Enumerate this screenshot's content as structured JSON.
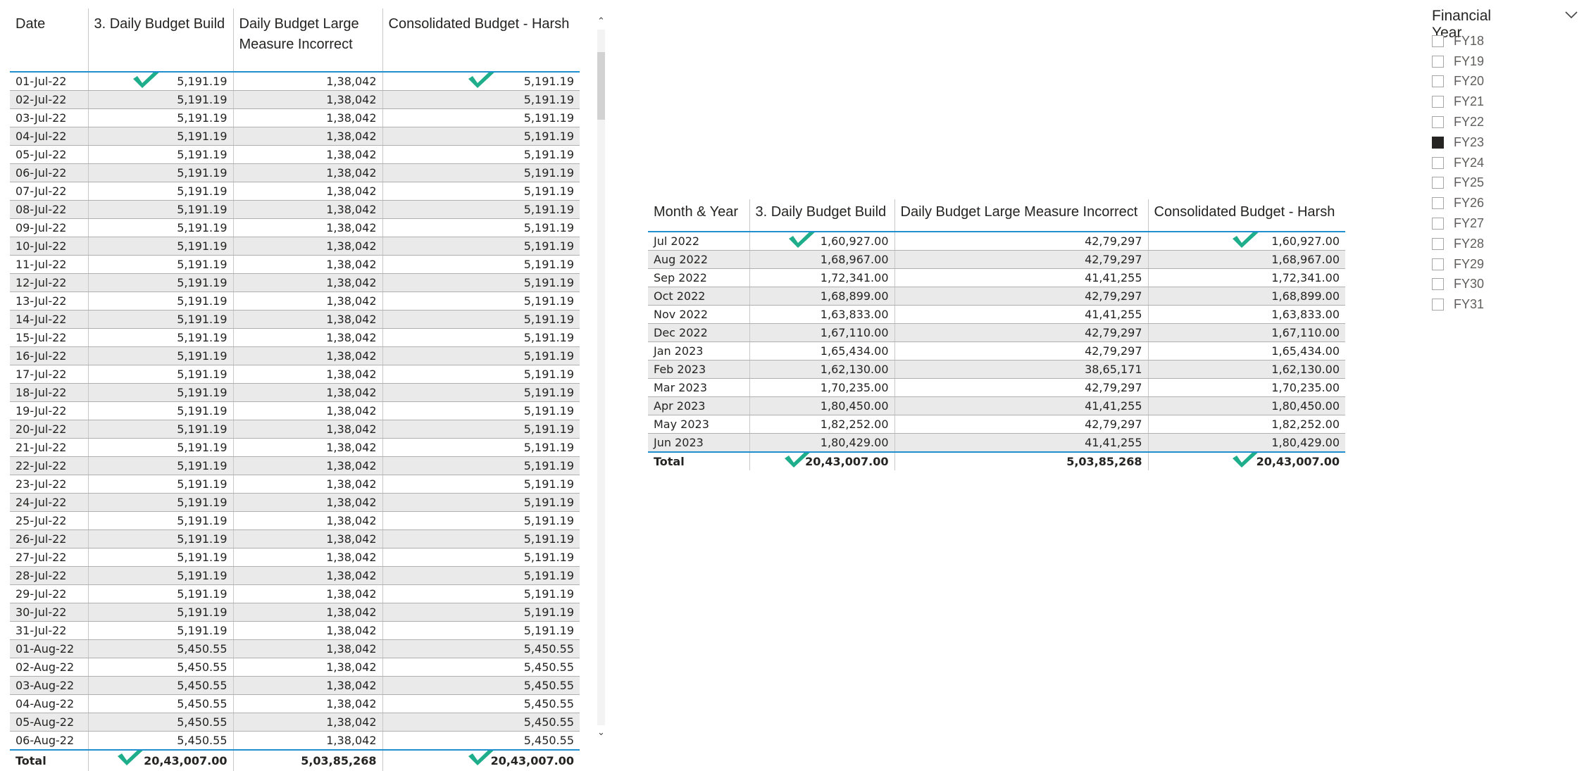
{
  "left_table": {
    "headers": [
      "Date",
      "3. Daily Budget Build",
      "Daily Budget Large Measure Incorrect",
      "Consolidated Budget - Harsh"
    ],
    "rows": [
      [
        "01-Jul-22",
        "5,191.19",
        "1,38,042",
        "5,191.19"
      ],
      [
        "02-Jul-22",
        "5,191.19",
        "1,38,042",
        "5,191.19"
      ],
      [
        "03-Jul-22",
        "5,191.19",
        "1,38,042",
        "5,191.19"
      ],
      [
        "04-Jul-22",
        "5,191.19",
        "1,38,042",
        "5,191.19"
      ],
      [
        "05-Jul-22",
        "5,191.19",
        "1,38,042",
        "5,191.19"
      ],
      [
        "06-Jul-22",
        "5,191.19",
        "1,38,042",
        "5,191.19"
      ],
      [
        "07-Jul-22",
        "5,191.19",
        "1,38,042",
        "5,191.19"
      ],
      [
        "08-Jul-22",
        "5,191.19",
        "1,38,042",
        "5,191.19"
      ],
      [
        "09-Jul-22",
        "5,191.19",
        "1,38,042",
        "5,191.19"
      ],
      [
        "10-Jul-22",
        "5,191.19",
        "1,38,042",
        "5,191.19"
      ],
      [
        "11-Jul-22",
        "5,191.19",
        "1,38,042",
        "5,191.19"
      ],
      [
        "12-Jul-22",
        "5,191.19",
        "1,38,042",
        "5,191.19"
      ],
      [
        "13-Jul-22",
        "5,191.19",
        "1,38,042",
        "5,191.19"
      ],
      [
        "14-Jul-22",
        "5,191.19",
        "1,38,042",
        "5,191.19"
      ],
      [
        "15-Jul-22",
        "5,191.19",
        "1,38,042",
        "5,191.19"
      ],
      [
        "16-Jul-22",
        "5,191.19",
        "1,38,042",
        "5,191.19"
      ],
      [
        "17-Jul-22",
        "5,191.19",
        "1,38,042",
        "5,191.19"
      ],
      [
        "18-Jul-22",
        "5,191.19",
        "1,38,042",
        "5,191.19"
      ],
      [
        "19-Jul-22",
        "5,191.19",
        "1,38,042",
        "5,191.19"
      ],
      [
        "20-Jul-22",
        "5,191.19",
        "1,38,042",
        "5,191.19"
      ],
      [
        "21-Jul-22",
        "5,191.19",
        "1,38,042",
        "5,191.19"
      ],
      [
        "22-Jul-22",
        "5,191.19",
        "1,38,042",
        "5,191.19"
      ],
      [
        "23-Jul-22",
        "5,191.19",
        "1,38,042",
        "5,191.19"
      ],
      [
        "24-Jul-22",
        "5,191.19",
        "1,38,042",
        "5,191.19"
      ],
      [
        "25-Jul-22",
        "5,191.19",
        "1,38,042",
        "5,191.19"
      ],
      [
        "26-Jul-22",
        "5,191.19",
        "1,38,042",
        "5,191.19"
      ],
      [
        "27-Jul-22",
        "5,191.19",
        "1,38,042",
        "5,191.19"
      ],
      [
        "28-Jul-22",
        "5,191.19",
        "1,38,042",
        "5,191.19"
      ],
      [
        "29-Jul-22",
        "5,191.19",
        "1,38,042",
        "5,191.19"
      ],
      [
        "30-Jul-22",
        "5,191.19",
        "1,38,042",
        "5,191.19"
      ],
      [
        "31-Jul-22",
        "5,191.19",
        "1,38,042",
        "5,191.19"
      ],
      [
        "01-Aug-22",
        "5,450.55",
        "1,38,042",
        "5,450.55"
      ],
      [
        "02-Aug-22",
        "5,450.55",
        "1,38,042",
        "5,450.55"
      ],
      [
        "03-Aug-22",
        "5,450.55",
        "1,38,042",
        "5,450.55"
      ],
      [
        "04-Aug-22",
        "5,450.55",
        "1,38,042",
        "5,450.55"
      ],
      [
        "05-Aug-22",
        "5,450.55",
        "1,38,042",
        "5,450.55"
      ],
      [
        "06-Aug-22",
        "5,450.55",
        "1,38,042",
        "5,450.55"
      ]
    ],
    "total": [
      "Total",
      "20,43,007.00",
      "5,03,85,268",
      "20,43,007.00"
    ]
  },
  "middle_table": {
    "headers": [
      "Month & Year",
      "3. Daily Budget Build",
      "Daily Budget Large Measure Incorrect",
      "Consolidated Budget - Harsh"
    ],
    "rows": [
      [
        "Jul 2022",
        "1,60,927.00",
        "42,79,297",
        "1,60,927.00"
      ],
      [
        "Aug 2022",
        "1,68,967.00",
        "42,79,297",
        "1,68,967.00"
      ],
      [
        "Sep 2022",
        "1,72,341.00",
        "41,41,255",
        "1,72,341.00"
      ],
      [
        "Oct 2022",
        "1,68,899.00",
        "42,79,297",
        "1,68,899.00"
      ],
      [
        "Nov 2022",
        "1,63,833.00",
        "41,41,255",
        "1,63,833.00"
      ],
      [
        "Dec 2022",
        "1,67,110.00",
        "42,79,297",
        "1,67,110.00"
      ],
      [
        "Jan 2023",
        "1,65,434.00",
        "42,79,297",
        "1,65,434.00"
      ],
      [
        "Feb 2023",
        "1,62,130.00",
        "38,65,171",
        "1,62,130.00"
      ],
      [
        "Mar 2023",
        "1,70,235.00",
        "42,79,297",
        "1,70,235.00"
      ],
      [
        "Apr 2023",
        "1,80,450.00",
        "41,41,255",
        "1,80,450.00"
      ],
      [
        "May 2023",
        "1,82,252.00",
        "42,79,297",
        "1,82,252.00"
      ],
      [
        "Jun 2023",
        "1,80,429.00",
        "41,41,255",
        "1,80,429.00"
      ]
    ],
    "total": [
      "Total",
      "20,43,007.00",
      "5,03,85,268",
      "20,43,007.00"
    ]
  },
  "slicer": {
    "title": "Financial Year",
    "items": [
      {
        "label": "FY18",
        "selected": false
      },
      {
        "label": "FY19",
        "selected": false
      },
      {
        "label": "FY20",
        "selected": false
      },
      {
        "label": "FY21",
        "selected": false
      },
      {
        "label": "FY22",
        "selected": false
      },
      {
        "label": "FY23",
        "selected": true
      },
      {
        "label": "FY24",
        "selected": false
      },
      {
        "label": "FY25",
        "selected": false
      },
      {
        "label": "FY26",
        "selected": false
      },
      {
        "label": "FY27",
        "selected": false
      },
      {
        "label": "FY28",
        "selected": false
      },
      {
        "label": "FY29",
        "selected": false
      },
      {
        "label": "FY30",
        "selected": false
      },
      {
        "label": "FY31",
        "selected": false
      }
    ]
  },
  "icons": {
    "checkmark": "checkmark-icon",
    "dropdown": "chevron-down-icon",
    "scroll_up": "scroll-up-arrow-icon",
    "scroll_down": "scroll-down-arrow-icon"
  },
  "colors": {
    "checkmark": "#1fae8c",
    "header_rule": "#1f8fd0",
    "band": "#eaeaea",
    "selected_box": "#252423"
  }
}
